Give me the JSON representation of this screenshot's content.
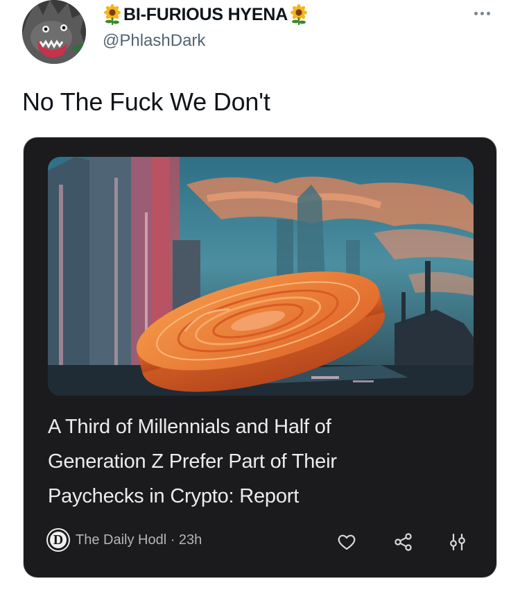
{
  "author": {
    "display_name": "BI-FURIOUS HYENA",
    "handle": "@PhlashDark"
  },
  "tweet": {
    "text": "No The Fuck We Don't"
  },
  "card": {
    "headline_lines": [
      "A Third of Millennials and Half of",
      "Generation Z Prefer Part of Their",
      "Paychecks in Crypto: Report"
    ],
    "source_logo_letter": "D",
    "source_text": "The Daily Hodl · 23h",
    "actions": [
      "heart-icon",
      "share-icon",
      "tune-icon"
    ]
  },
  "colors": {
    "card_bg": "#1b1b1d",
    "headline": "#ececec",
    "coin": "#e2752f",
    "handle": "#536471"
  }
}
